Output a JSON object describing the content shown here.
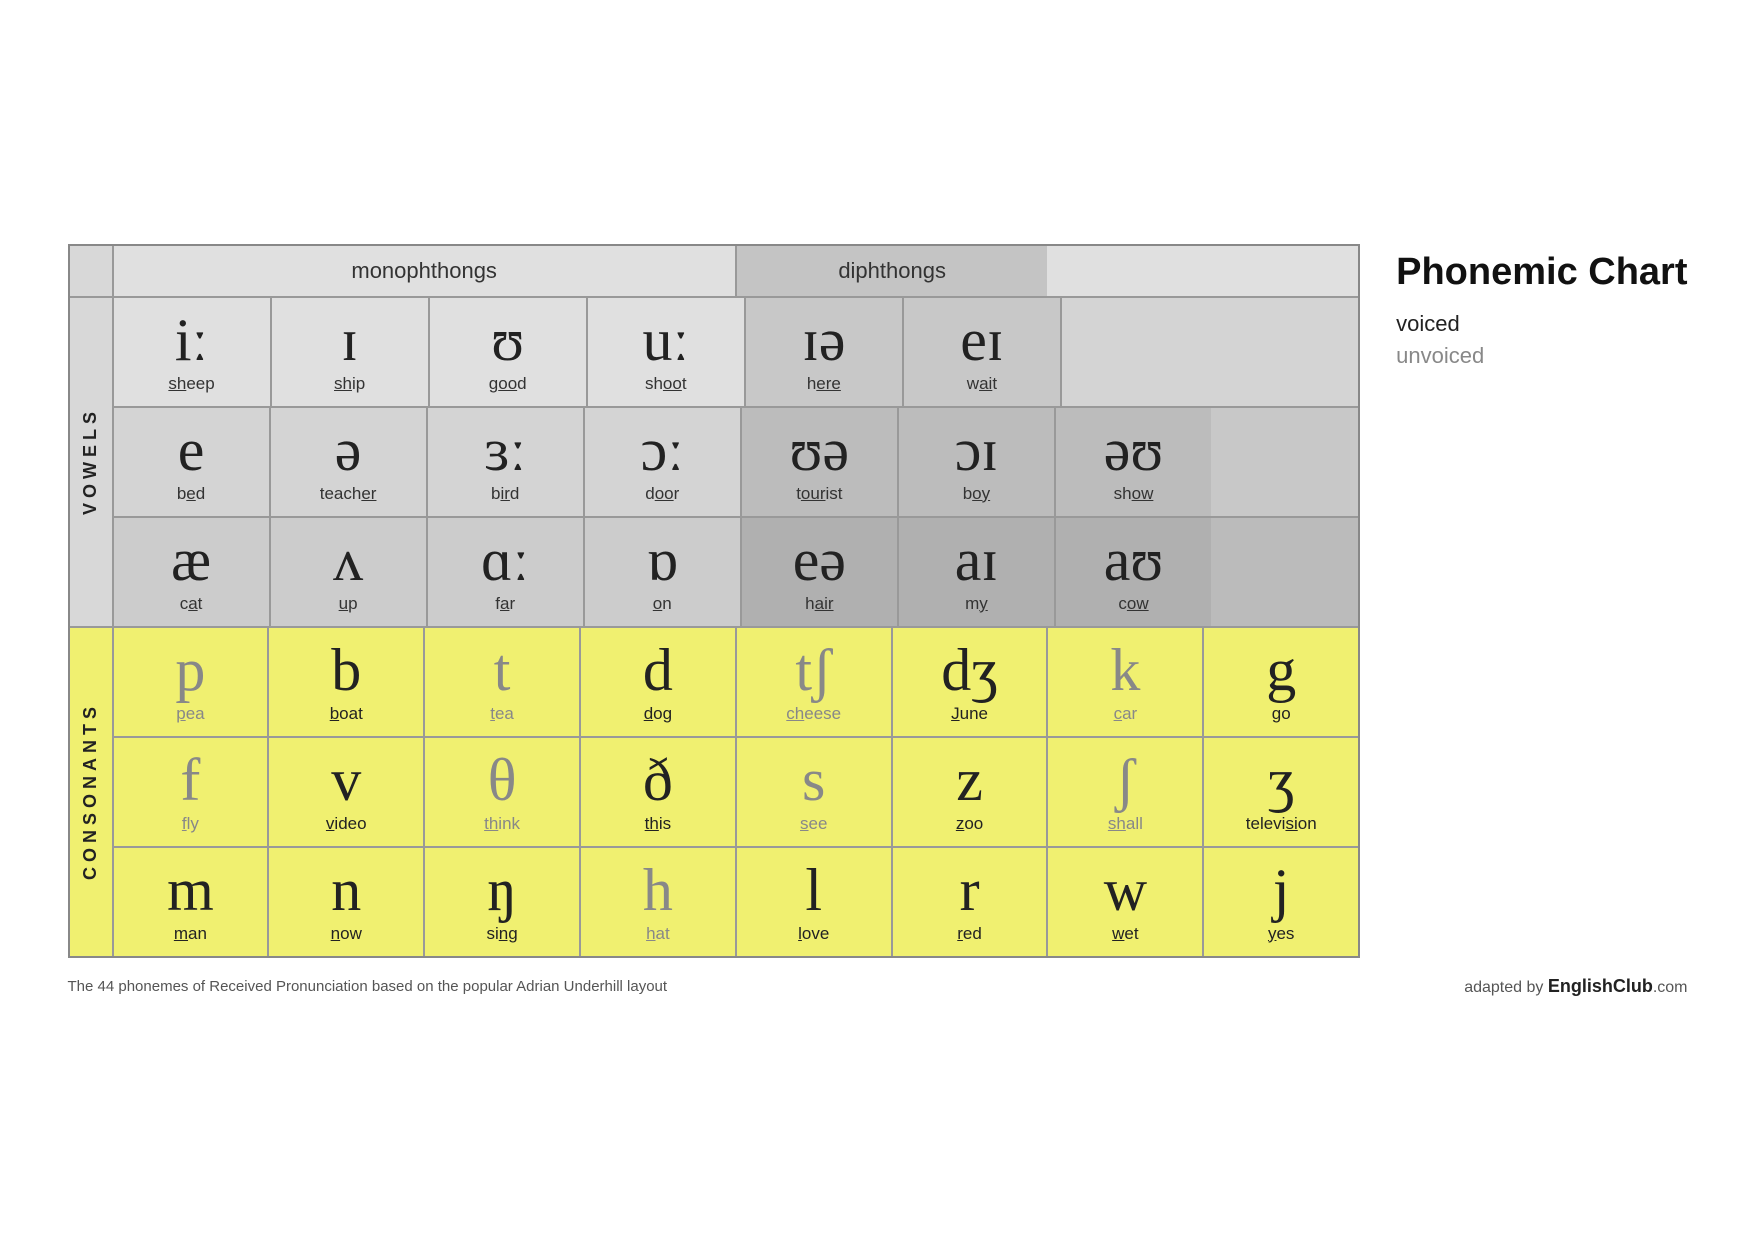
{
  "title": "Phonemic Chart",
  "legend": {
    "voiced": "voiced",
    "unvoiced": "unvoiced"
  },
  "header": {
    "monophthongs": "monophthongs",
    "diphthongs": "diphthongs"
  },
  "labels": {
    "vowels": "VOWELS",
    "consonants": "CONSONANTS"
  },
  "vowels": {
    "row1": [
      {
        "symbol": "iː",
        "word": "sheep",
        "underline": "sh"
      },
      {
        "symbol": "ɪ",
        "word": "ship",
        "underline": "sh"
      },
      {
        "symbol": "ʊ",
        "word": "good",
        "underline": "oo"
      },
      {
        "symbol": "uː",
        "word": "shoot",
        "underline": "oo"
      },
      {
        "symbol": "ɪə",
        "word": "here",
        "underline": "ere"
      },
      {
        "symbol": "eɪ",
        "word": "wait",
        "underline": "ai"
      }
    ],
    "row2": [
      {
        "symbol": "e",
        "word": "bed",
        "underline": "e"
      },
      {
        "symbol": "ə",
        "word": "teacher",
        "underline": "er"
      },
      {
        "symbol": "ɜː",
        "word": "bird",
        "underline": "ir"
      },
      {
        "symbol": "ɔː",
        "word": "door",
        "underline": "oo"
      },
      {
        "symbol": "ʊə",
        "word": "tourist",
        "underline": "our"
      },
      {
        "symbol": "ɔɪ",
        "word": "boy",
        "underline": "oy"
      },
      {
        "symbol": "əʊ",
        "word": "show",
        "underline": "ow"
      }
    ],
    "row3": [
      {
        "symbol": "æ",
        "word": "cat",
        "underline": "a"
      },
      {
        "symbol": "ʌ",
        "word": "up",
        "underline": "u"
      },
      {
        "symbol": "ɑː",
        "word": "far",
        "underline": "a"
      },
      {
        "symbol": "ɒ",
        "word": "on",
        "underline": "o"
      },
      {
        "symbol": "eə",
        "word": "hair",
        "underline": "air"
      },
      {
        "symbol": "aɪ",
        "word": "my",
        "underline": "y"
      },
      {
        "symbol": "aʊ",
        "word": "cow",
        "underline": "ow"
      }
    ]
  },
  "consonants": {
    "row1": [
      {
        "symbol": "p",
        "word": "pea",
        "underline": "p",
        "voiced": false
      },
      {
        "symbol": "b",
        "word": "boat",
        "underline": "b",
        "voiced": true
      },
      {
        "symbol": "t",
        "word": "tea",
        "underline": "t",
        "voiced": false
      },
      {
        "symbol": "d",
        "word": "dog",
        "underline": "d",
        "voiced": true
      },
      {
        "symbol": "tʃ",
        "word": "cheese",
        "underline": "ch",
        "voiced": false
      },
      {
        "symbol": "dʒ",
        "word": "June",
        "underline": "J",
        "voiced": true
      },
      {
        "symbol": "k",
        "word": "car",
        "underline": "c",
        "voiced": false
      },
      {
        "symbol": "g",
        "word": "go",
        "underline": "g",
        "voiced": true
      }
    ],
    "row2": [
      {
        "symbol": "f",
        "word": "fly",
        "underline": "f",
        "voiced": false
      },
      {
        "symbol": "v",
        "word": "video",
        "underline": "v",
        "voiced": true
      },
      {
        "symbol": "θ",
        "word": "think",
        "underline": "th",
        "voiced": false
      },
      {
        "symbol": "ð",
        "word": "this",
        "underline": "th",
        "voiced": true
      },
      {
        "symbol": "s",
        "word": "see",
        "underline": "s",
        "voiced": false
      },
      {
        "symbol": "z",
        "word": "zoo",
        "underline": "z",
        "voiced": true
      },
      {
        "symbol": "ʃ",
        "word": "shall",
        "underline": "sh",
        "voiced": false
      },
      {
        "symbol": "ʒ",
        "word": "television",
        "underline": "si",
        "voiced": true
      }
    ],
    "row3": [
      {
        "symbol": "m",
        "word": "man",
        "underline": "m",
        "voiced": true
      },
      {
        "symbol": "n",
        "word": "now",
        "underline": "n",
        "voiced": true
      },
      {
        "symbol": "ŋ",
        "word": "sing",
        "underline": "ng",
        "voiced": true
      },
      {
        "symbol": "h",
        "word": "hat",
        "underline": "h",
        "voiced": false
      },
      {
        "symbol": "l",
        "word": "love",
        "underline": "l",
        "voiced": true
      },
      {
        "symbol": "r",
        "word": "red",
        "underline": "r",
        "voiced": true
      },
      {
        "symbol": "w",
        "word": "wet",
        "underline": "w",
        "voiced": true
      },
      {
        "symbol": "j",
        "word": "yes",
        "underline": "y",
        "voiced": true
      }
    ]
  },
  "footnote": {
    "left": "The 44 phonemes of Received Pronunciation based on the popular Adrian Underhill layout",
    "right_prefix": "adapted by ",
    "right_brand": "EnglishClub",
    "right_suffix": ".com"
  }
}
